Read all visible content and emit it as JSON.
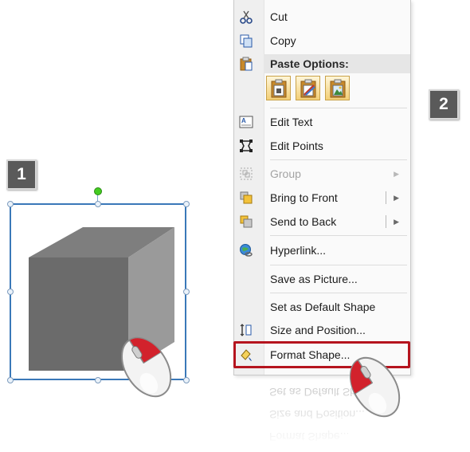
{
  "badges": {
    "step1": "1",
    "step2": "2"
  },
  "menu": {
    "items": [
      {
        "label": "Cut",
        "icon": "scissors-icon"
      },
      {
        "label": "Copy",
        "icon": "copy-icon"
      },
      {
        "label": "Paste Options:",
        "icon": "clipboard-icon"
      },
      {
        "label": "Edit Text",
        "icon": "edit-text-icon"
      },
      {
        "label": "Edit Points",
        "icon": "edit-points-icon"
      },
      {
        "label": "Group",
        "icon": "group-icon",
        "disabled": true
      },
      {
        "label": "Bring to Front",
        "icon": "bring-to-front-icon"
      },
      {
        "label": "Send to Back",
        "icon": "send-to-back-icon"
      },
      {
        "label": "Hyperlink...",
        "icon": "hyperlink-icon"
      },
      {
        "label": "Save as Picture...",
        "icon": ""
      },
      {
        "label": "Set as Default Shape",
        "icon": ""
      },
      {
        "label": "Size and Position...",
        "icon": "size-position-icon"
      },
      {
        "label": "Format Shape...",
        "icon": "format-shape-icon"
      }
    ],
    "paste_buttons": [
      "paste-keep-text-icon",
      "paste-use-destination-icon",
      "paste-picture-icon"
    ],
    "reflection_labels": [
      "Format Shape...",
      "Size and Position...",
      "Set as Default Shape"
    ]
  },
  "colors": {
    "highlight": "#b5141e",
    "selection": "#3a78b8",
    "cube_front": "#6b6b6b",
    "cube_top": "#7e7e7e",
    "cube_side": "#9a9a9a"
  }
}
